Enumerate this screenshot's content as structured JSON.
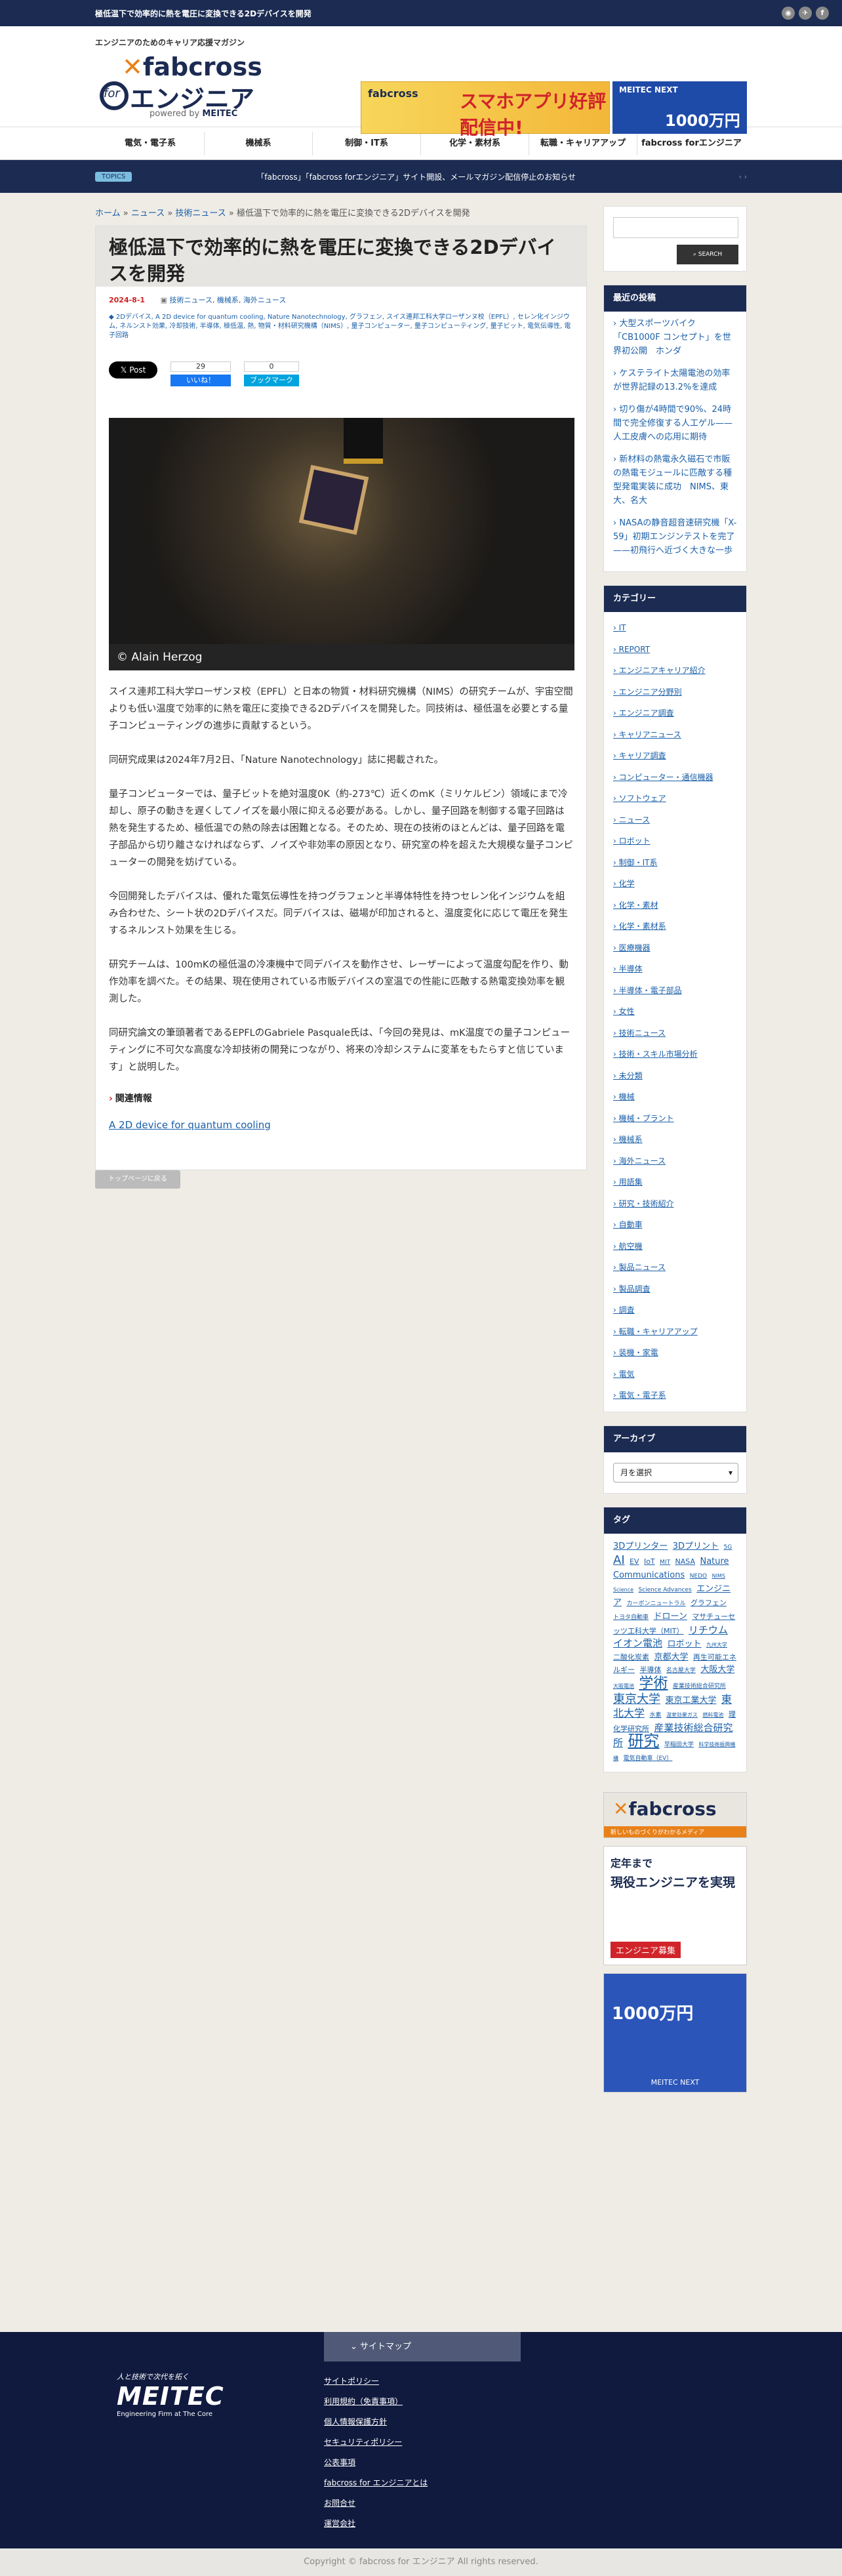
{
  "topbar": {
    "title": "極低温下で効率的に熱を電圧に変換できる2Dデバイスを開発"
  },
  "header": {
    "tagline": "エンジニアのためのキャリア応援マガジン",
    "logo_fab": "fabcross",
    "logo_for": "for",
    "logo_eng": "エンジニア",
    "logo_pw": "powered by",
    "logo_brand": "MEITEC",
    "banner1_small": "fabcross",
    "banner1_text": "スマホアプリ好評配信中!",
    "banner2_text": "MEITEC NEXT",
    "banner2_sub": "1000万円"
  },
  "nav": [
    "電気・電子系",
    "機械系",
    "制御・IT系",
    "化学・素材系",
    "転職・キャリアアップ",
    "fabcross forエンジニア"
  ],
  "topics": {
    "badge": "TOPICS",
    "text": "「fabcross」「fabcross forエンジニア」サイト開設、メールマガジン配信停止のお知らせ"
  },
  "breadcrumb": {
    "home": "ホーム",
    "news": "ニュース",
    "tech": "技術ニュース",
    "current": "極低温下で効率的に熱を電圧に変換できる2Dデバイスを開発"
  },
  "article": {
    "title": "極低温下で効率的に熱を電圧に変換できる2Dデバイスを開発",
    "date": "2024-8-1",
    "categories": "技術ニュース, 機械系, 海外ニュース",
    "tags": "2Dデバイス, A 2D device for quantum cooling, Nature Nanotechnology, グラフェン, スイス連邦工科大学ローザンヌ校（EPFL）, セレン化インジウム, ネルンスト効果, 冷却技術, 半導体, 極低温, 熱, 物質・材料研究機構（NIMS）, 量子コンピューター, 量子コンピューティング, 量子ビット, 電気伝導性, 電子回路",
    "share_x": "Post",
    "fb_count": "29",
    "fb_like": "いいね！",
    "hb_count": "0",
    "hb_label": "ブックマーク",
    "photo_caption": "© Alain Herzog",
    "paragraphs": [
      "スイス連邦工科大学ローザンヌ校（EPFL）と日本の物質・材料研究機構（NIMS）の研究チームが、宇宙空間よりも低い温度で効率的に熱を電圧に変換できる2Dデバイスを開発した。同技術は、極低温を必要とする量子コンピューティングの進歩に貢献するという。",
      "同研究成果は2024年7月2日、「Nature Nanotechnology」誌に掲載された。",
      "量子コンピューターでは、量子ビットを絶対温度0K（約-273℃）近くのmK（ミリケルビン）領域にまで冷却し、原子の動きを遅くしてノイズを最小限に抑える必要がある。しかし、量子回路を制御する電子回路は熱を発生するため、極低温での熱の除去は困難となる。そのため、現在の技術のほとんどは、量子回路を電子部品から切り離さなければならず、ノイズや非効率の原因となり、研究室の枠を超えた大規模な量子コンピューターの開発を妨げている。",
      "今回開発したデバイスは、優れた電気伝導性を持つグラフェンと半導体特性を持つセレン化インジウムを組み合わせた、シート状の2Dデバイスだ。同デバイスは、磁場が印加されると、温度変化に応じて電圧を発生するネルンスト効果を生じる。",
      "研究チームは、100mKの極低温の冷凍機中で同デバイスを動作させ、レーザーによって温度勾配を作り、動作効率を調べた。その結果、現在使用されている市販デバイスの室温での性能に匹敵する熱電変換効率を観測した。",
      "同研究論文の筆頭著者であるEPFLのGabriele Pasquale氏は、「今回の発見は、mK温度での量子コンピューティングに不可欠な高度な冷却技術の開発につながり、将来の冷却システムに変革をもたらすと信じています」と説明した。"
    ],
    "related_heading": "関連情報",
    "related_link": "A 2D device for quantum cooling"
  },
  "toplink": "トップページに戻る",
  "search": {
    "button": "SEARCH"
  },
  "sidebar": {
    "recent_title": "最近の投稿",
    "recent": [
      "大型スポーツバイク「CB1000F コンセプト」を世界初公開　ホンダ",
      "ケステライト太陽電池の効率が世界記録の13.2%を達成",
      "切り傷が4時間で90%、24時間で完全修復する人工ゲル——人工皮膚への応用に期待",
      "新材料の熱電永久磁石で市販の熱電モジュールに匹敵する種型発電実装に成功　NIMS、東大、名大",
      "NASAの静音超音速研究機「X-59」初期エンジンテストを完了——初飛行へ近づく大きな一歩"
    ],
    "cat_title": "カテゴリー",
    "categories": [
      "IT",
      "REPORT",
      "エンジニアキャリア紹介",
      "エンジニア分野別",
      "エンジニア調査",
      "キャリアニュース",
      "キャリア調査",
      "コンピューター・通信機器",
      "ソフトウェア",
      "ニュース",
      "ロボット",
      "制御・IT系",
      "化学",
      "化学・素材",
      "化学・素材系",
      "医療機器",
      "半導体",
      "半導体・電子部品",
      "女性",
      "技術ニュース",
      "技術・スキル市場分析",
      "未分類",
      "機械",
      "機械・プラント",
      "機械系",
      "海外ニュース",
      "用語集",
      "研究・技術紹介",
      "自動車",
      "航空機",
      "製品ニュース",
      "製品調査",
      "調査",
      "転職・キャリアアップ",
      "装機・家電",
      "電気",
      "電気・電子系"
    ],
    "archive_title": "アーカイブ",
    "archive_select": "月を選択",
    "tag_title": "タグ",
    "tags": [
      "3Dプリンター",
      "3Dプリント",
      "5G",
      "AI",
      "EV",
      "IoT",
      "MIT",
      "NASA",
      "Nature Communications",
      "NEDO",
      "NIMS",
      "Science",
      "Science Advances",
      "エンジニア",
      "カーボンニュートラル",
      "グラフェン",
      "トヨタ自動車",
      "ドローン",
      "マサチューセッツ工科大学（MIT）",
      "リチウムイオン電池",
      "ロボット",
      "九州大学",
      "二酸化炭素",
      "京都大学",
      "再生可能エネルギー",
      "半導体",
      "名古屋大学",
      "大阪大学",
      "大阪電池",
      "学術",
      "産業技術総合研究所",
      "東京大学",
      "東京工業大学",
      "東北大学",
      "水素",
      "温室効果ガス",
      "燃料電池",
      "理化学研究所",
      "産業技術総合研究所",
      "研究",
      "早稲田大学",
      "科学技術振興機構",
      "電気自動車（EV）"
    ]
  },
  "ads": {
    "ad1_title": "fabcross",
    "ad1_sub": "新しいものづくりがわかるメディア",
    "ad2_line1": "定年まで",
    "ad2_line2": "現役エンジニアを実現",
    "ad2_line3": "エンジニア募集",
    "ad3_line1": "1000万円",
    "ad3_brand": "MEITEC NEXT"
  },
  "footer": {
    "slogan": "人と技術で次代を拓く",
    "brand": "MEITEC",
    "sub": "Engineering Firm at The Core",
    "sitemap": "サイトマップ",
    "links": [
      "サイトポリシー",
      "利用規約（免責事項）",
      "個人情報保護方針",
      "セキュリティポリシー",
      "公表事項",
      "fabcross for エンジニアとは",
      "お問合せ",
      "運営会社"
    ],
    "copyright": "Copyright ©  fabcross for エンジニア All rights reserved."
  }
}
